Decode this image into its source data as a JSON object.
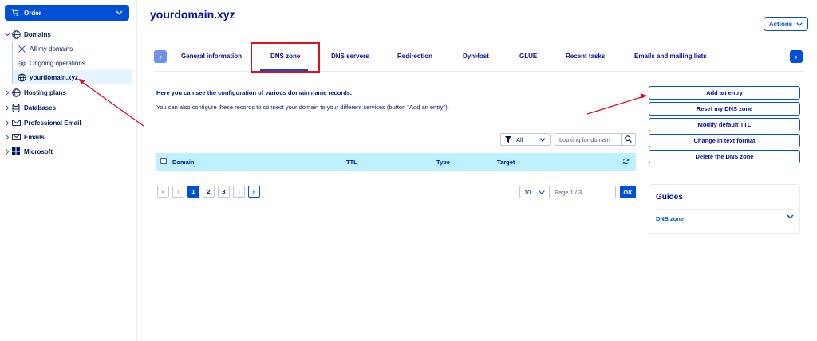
{
  "sidebar": {
    "order_label": "Order",
    "items": [
      {
        "label": "Domains"
      },
      {
        "label": "Hosting plans"
      },
      {
        "label": "Databases"
      },
      {
        "label": "Professional Email"
      },
      {
        "label": "Emails"
      },
      {
        "label": "Microsoft"
      }
    ],
    "domain_subitems": [
      {
        "label": "All my domains"
      },
      {
        "label": "Ongoing operations"
      },
      {
        "label": "yourdomain.xyz"
      }
    ]
  },
  "header": {
    "title": "yourdomain.xyz",
    "actions_label": "Actions"
  },
  "tabs": [
    {
      "label": "General information"
    },
    {
      "label": "DNS zone",
      "active": true
    },
    {
      "label": "DNS servers"
    },
    {
      "label": "Redirection"
    },
    {
      "label": "DynHost"
    },
    {
      "label": "GLUE"
    },
    {
      "label": "Recent tasks"
    },
    {
      "label": "Emails and mailing lists"
    }
  ],
  "intro": {
    "line1": "Here you can see the configuration of various domain name records.",
    "line2": "You can also configure these records to connect your domain to your different services (button \"Add an entry\")."
  },
  "side_buttons": [
    {
      "label": "Add an entry"
    },
    {
      "label": "Reset my DNS zone"
    },
    {
      "label": "Modify default TTL"
    },
    {
      "label": "Change in text format"
    },
    {
      "label": "Delete the DNS zone"
    }
  ],
  "filter": {
    "selected": "All",
    "search_placeholder": "Looking for domain"
  },
  "table": {
    "columns": [
      "Domain",
      "TTL",
      "Type",
      "Target"
    ]
  },
  "pagination": {
    "pages": [
      "1",
      "2",
      "3"
    ],
    "current_page": 1,
    "per_page": "10",
    "page_placeholder": "Page 1 / 3",
    "ok_label": "OK"
  },
  "guides": {
    "title": "Guides",
    "item": "DNS zone"
  },
  "colors": {
    "primary": "#0050d7",
    "title": "#000e9c",
    "table_header": "#bef1ff",
    "annotation_red": "#e00e1f",
    "selected_row": "#e6f4ff"
  }
}
